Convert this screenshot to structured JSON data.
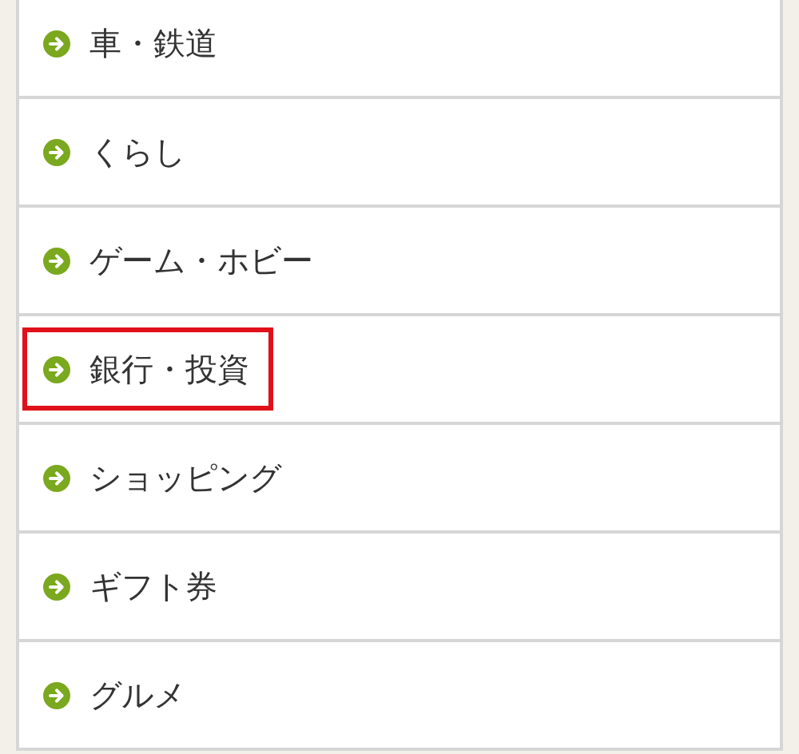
{
  "items": [
    {
      "label": "車・鉄道",
      "highlighted": false
    },
    {
      "label": "くらし",
      "highlighted": false
    },
    {
      "label": "ゲーム・ホビー",
      "highlighted": false
    },
    {
      "label": "銀行・投資",
      "highlighted": true
    },
    {
      "label": "ショッピング",
      "highlighted": false
    },
    {
      "label": "ギフト券",
      "highlighted": false
    },
    {
      "label": "グルメ",
      "highlighted": false
    }
  ]
}
